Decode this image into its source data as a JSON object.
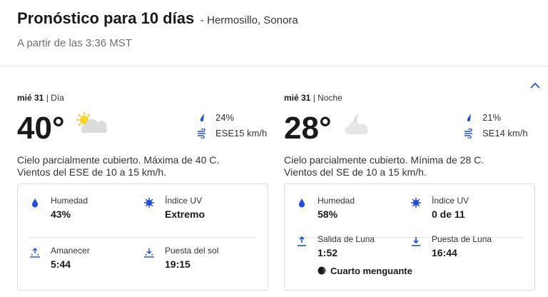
{
  "header": {
    "title": "Pronóstico para 10 días",
    "separator": "-",
    "location": "Hermosillo, Sonora",
    "as_of": "A partir de las 3:36 MST"
  },
  "colors": {
    "accent": "#1b4de4",
    "text": "#1a1a1a",
    "muted": "#6f6f6f",
    "border": "#dcdcdc"
  },
  "day": {
    "date": "mié 31",
    "period": "| Día",
    "temp": "40°",
    "icon": "partly-cloudy-sun-icon",
    "precip": "24%",
    "wind": "ESE15 km/h",
    "description_1": "Cielo parcialmente cubierto. Máxima de 40 C.",
    "description_2": "Vientos del ESE de 10 a 15 km/h.",
    "details": {
      "humidity_label": "Humedad",
      "humidity_value": "43%",
      "uv_label": "Índice UV",
      "uv_value": "Extremo",
      "sunrise_label": "Amanecer",
      "sunrise_value": "5:44",
      "sunset_label": "Puesta del sol",
      "sunset_value": "19:15"
    }
  },
  "night": {
    "date": "mié 31",
    "period": "| Noche",
    "temp": "28°",
    "icon": "partly-cloudy-moon-icon",
    "precip": "21%",
    "wind": "SE14 km/h",
    "description_1": "Cielo parcialmente cubierto. Mínima de 28 C.",
    "description_2": "Vientos del SE de 10 a 15 km/h.",
    "details": {
      "humidity_label": "Humedad",
      "humidity_value": "58%",
      "uv_label": "Índice UV",
      "uv_value": "0 de 11",
      "moonrise_label": "Salida de Luna",
      "moonrise_value": "1:52",
      "moonset_label": "Puesta de Luna",
      "moonset_value": "16:44",
      "moon_phase": "Cuarto menguante"
    }
  }
}
